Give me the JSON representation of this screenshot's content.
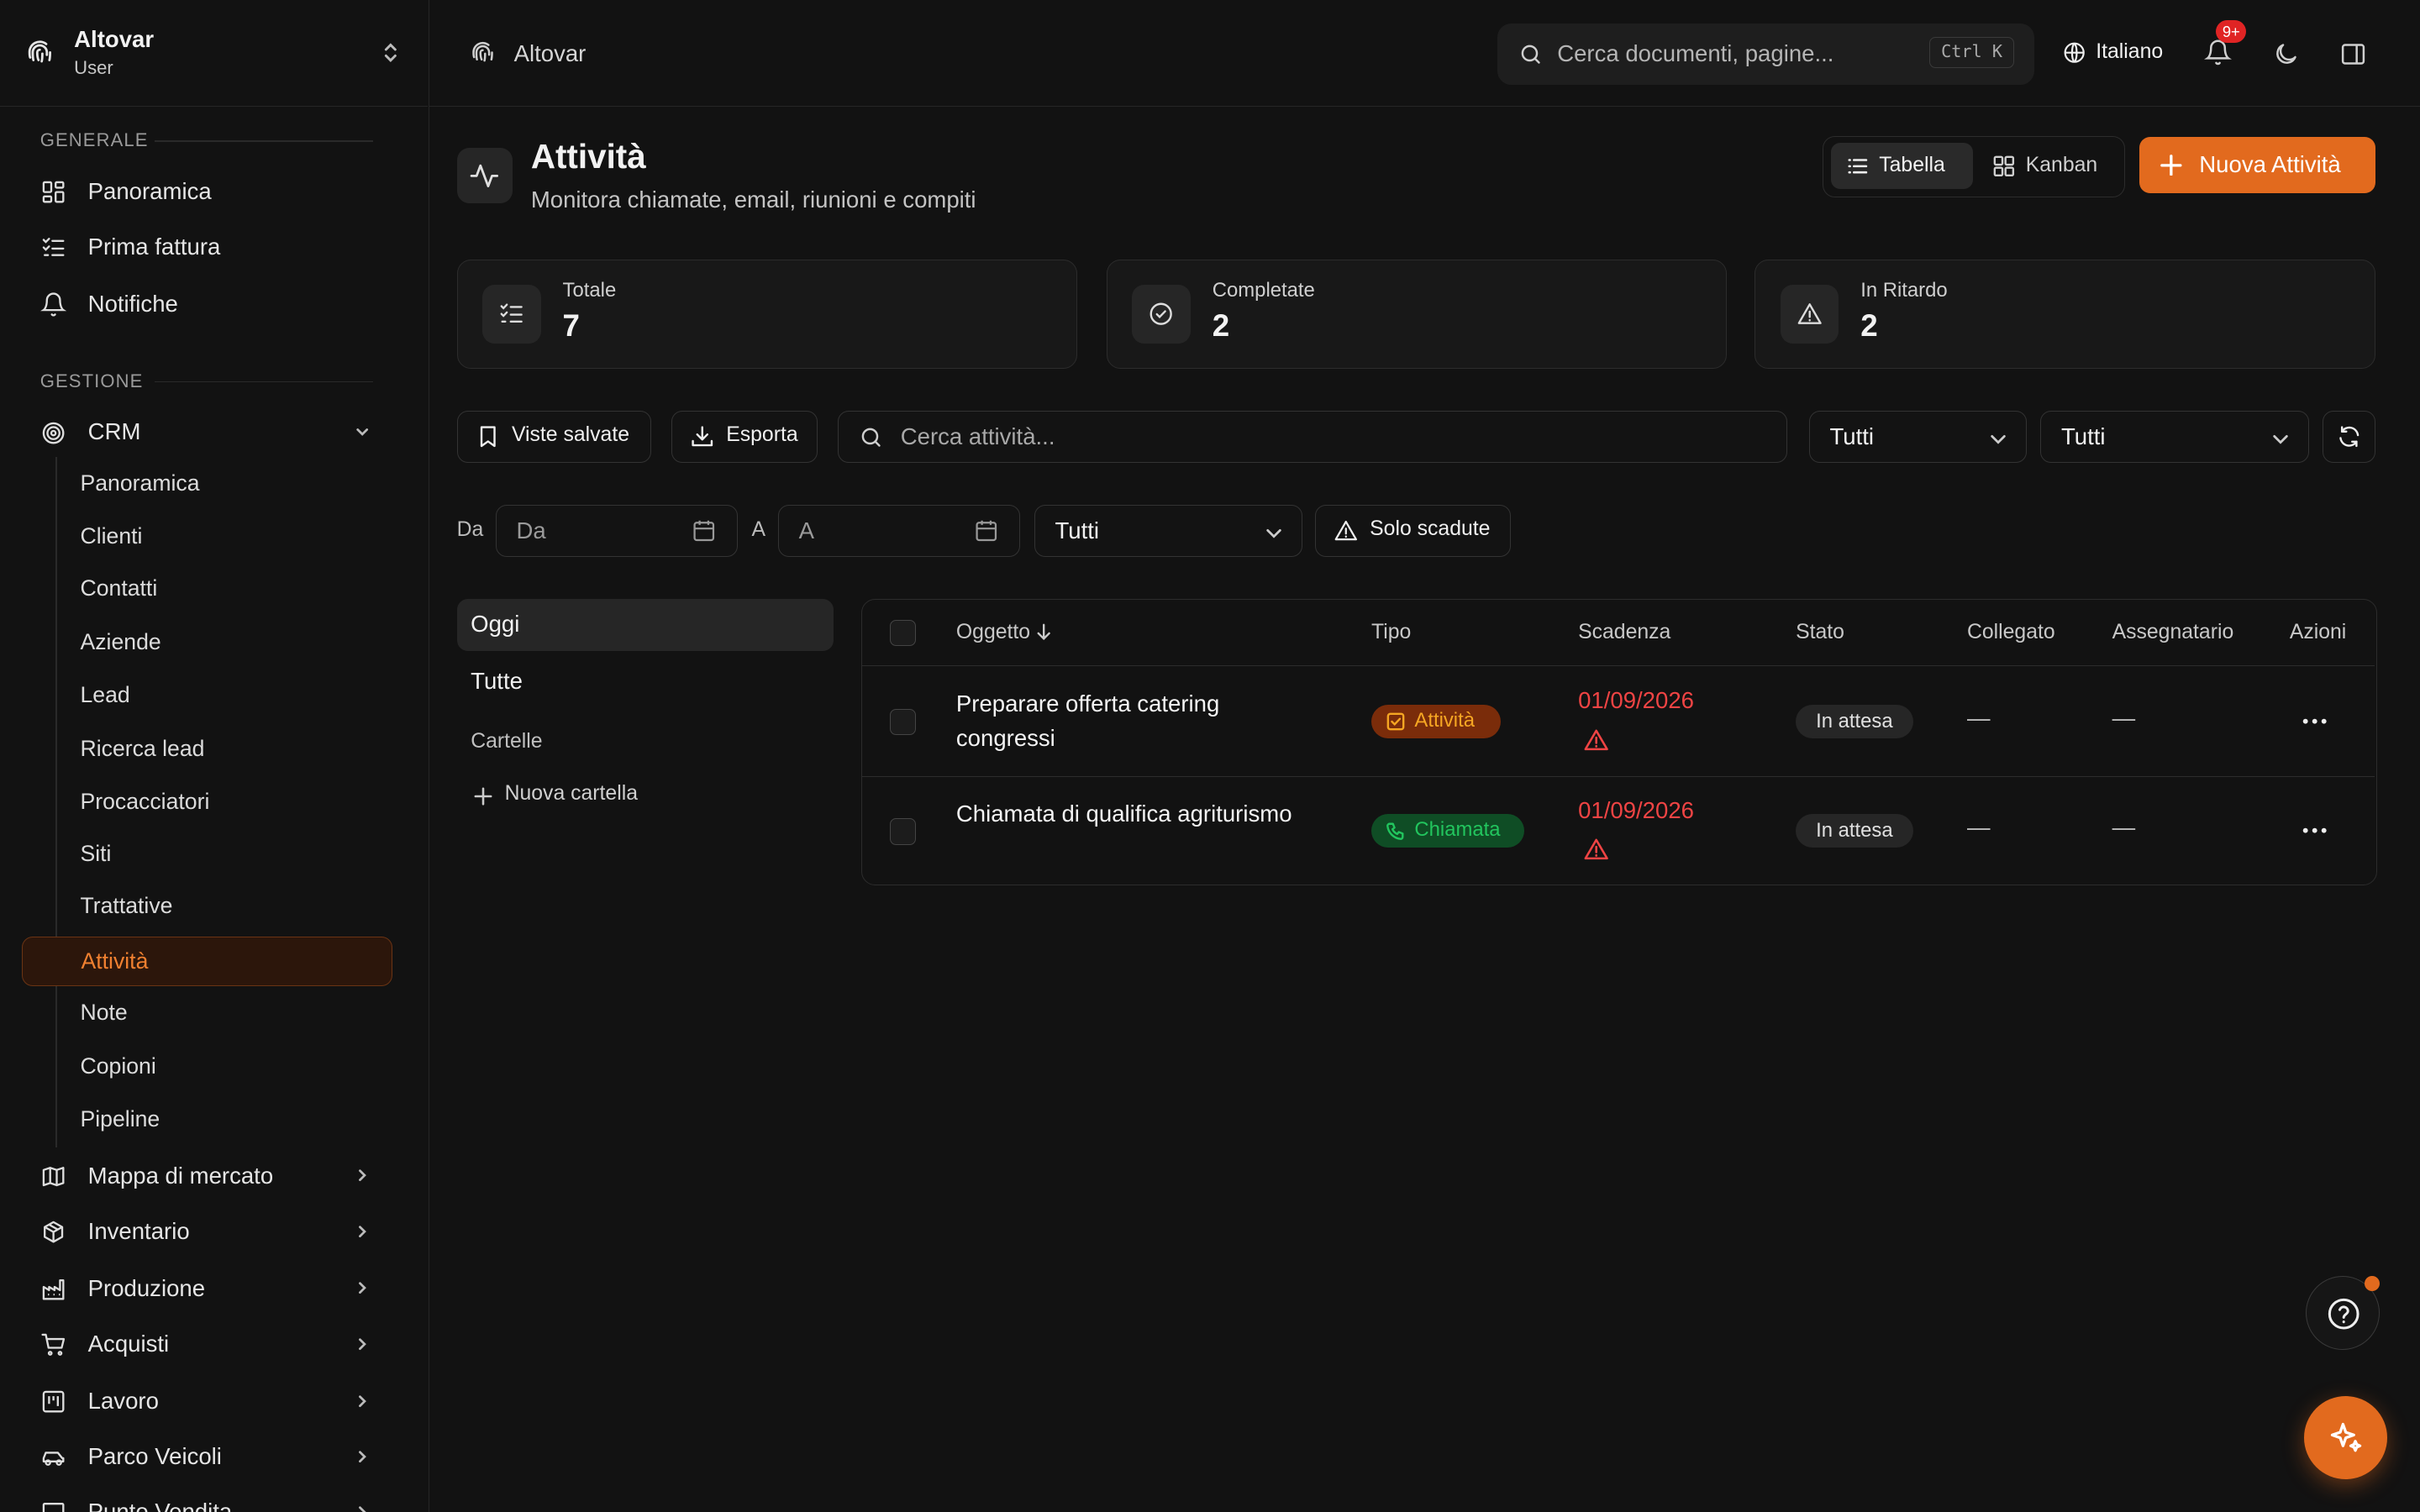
{
  "sidebar": {
    "brand_name": "Altovar",
    "brand_role": "User",
    "section_general": "GENERALE",
    "general_items": [
      {
        "label": "Panoramica",
        "icon": "dashboard-icon"
      },
      {
        "label": "Prima fattura",
        "icon": "checklist-icon"
      },
      {
        "label": "Notifiche",
        "icon": "bell-icon"
      }
    ],
    "section_manage": "GESTIONE",
    "crm_label": "CRM",
    "crm_items": [
      "Panoramica",
      "Clienti",
      "Contatti",
      "Aziende",
      "Lead",
      "Ricerca lead",
      "Procacciatori",
      "Siti",
      "Trattative",
      "Attività",
      "Note",
      "Copioni",
      "Pipeline"
    ],
    "crm_active": "Attività",
    "groups": [
      {
        "label": "Mappa di mercato",
        "icon": "map-icon"
      },
      {
        "label": "Inventario",
        "icon": "package-icon"
      },
      {
        "label": "Produzione",
        "icon": "factory-icon"
      },
      {
        "label": "Acquisti",
        "icon": "cart-icon"
      },
      {
        "label": "Lavoro",
        "icon": "kanban-icon"
      },
      {
        "label": "Parco Veicoli",
        "icon": "car-icon"
      },
      {
        "label": "Punto Vendita",
        "icon": "pos-icon"
      }
    ]
  },
  "topbar": {
    "breadcrumb": "Altovar",
    "search_placeholder": "Cerca documenti, pagine...",
    "search_shortcut": "Ctrl K",
    "language": "Italiano",
    "notifications_badge": "9+"
  },
  "page": {
    "title": "Attività",
    "subtitle": "Monitora chiamate, email, riunioni e compiti",
    "view_table": "Tabella",
    "view_kanban": "Kanban",
    "new_button": "Nuova Attività"
  },
  "stats": [
    {
      "label": "Totale",
      "value": "7",
      "icon": "list-check-icon"
    },
    {
      "label": "Completate",
      "value": "2",
      "icon": "check-circle-icon"
    },
    {
      "label": "In Ritardo",
      "value": "2",
      "icon": "warning-icon"
    }
  ],
  "toolbar": {
    "saved_views": "Viste salvate",
    "export": "Esporta",
    "search_placeholder": "Cerca attività...",
    "filter1": "Tutti",
    "filter2": "Tutti",
    "from_label": "Da",
    "from_placeholder": "Da",
    "to_label": "A",
    "to_placeholder": "A",
    "filter3": "Tutti",
    "overdue_only": "Solo scadute"
  },
  "folders": {
    "today": "Oggi",
    "all": "Tutte",
    "section": "Cartelle",
    "new_folder": "Nuova cartella"
  },
  "table": {
    "headers": {
      "subject": "Oggetto",
      "type": "Tipo",
      "due": "Scadenza",
      "status": "Stato",
      "linked": "Collegato",
      "assignee": "Assegnatario",
      "actions": "Azioni"
    },
    "rows": [
      {
        "subject": "Preparare offerta catering congressi",
        "type": "Attività",
        "type_color": "#f5a623",
        "due": "01/09/2026",
        "status": "In attesa",
        "linked": "—",
        "assignee": "—"
      },
      {
        "subject": "Chiamata di qualifica agriturismo",
        "type": "Chiamata",
        "type_color": "#22c55e",
        "due": "01/09/2026",
        "status": "In attesa",
        "linked": "—",
        "assignee": "—"
      }
    ]
  },
  "colors": {
    "accent": "#e26a1e",
    "danger": "#ef4444",
    "background": "#121212"
  }
}
